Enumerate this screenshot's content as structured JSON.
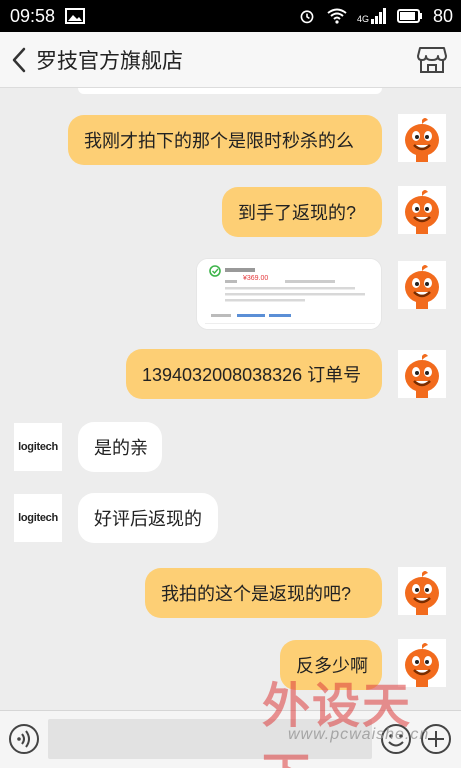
{
  "status_bar": {
    "time": "09:58",
    "signal_label": "4G",
    "battery": "80"
  },
  "header": {
    "title": "罗技官方旗舰店",
    "back_icon": "chevron-left-icon",
    "store_icon": "store-icon"
  },
  "messages": [
    {
      "from": "me",
      "text": "我刚才拍下的那个是限时秒杀的么"
    },
    {
      "from": "me",
      "text": "到手了返现的?"
    },
    {
      "from": "me",
      "type": "image"
    },
    {
      "from": "me",
      "text": "1394032008038326 订单号"
    },
    {
      "from": "shop",
      "text": "是的亲"
    },
    {
      "from": "shop",
      "text": "好评后返现的"
    },
    {
      "from": "me",
      "text": "我拍的这个是返现的吧?"
    },
    {
      "from": "me",
      "text": "反多少啊"
    }
  ],
  "shop_avatar_text": "logitech",
  "image_preview": {
    "price": "¥369.00"
  },
  "input_bar": {
    "voice_icon": "voice-icon",
    "emoji_icon": "emoji-icon",
    "plus_icon": "plus-icon"
  },
  "watermark": {
    "text": "外设天下",
    "url": "www.pcwaishe.cn"
  },
  "colors": {
    "my_bubble": "#fdcf75",
    "their_bubble": "#ffffff",
    "background": "#ededed"
  }
}
